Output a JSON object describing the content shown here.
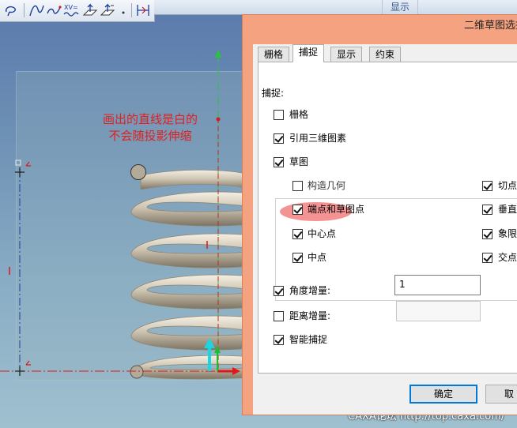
{
  "viewport": {
    "annotation": [
      "画出的直线是白的",
      "不会随投影伸缩"
    ],
    "annotation_color": "#e02020",
    "toolbar_icons": [
      "lasso-icon",
      "spline-icon",
      "curve-icon",
      "text-curve-icon",
      "plane-arrow-icon",
      "plane-arrow-2-icon",
      "point-icon",
      "reference-icon"
    ],
    "top_tab": "显示",
    "watermark": "CAXA论坛 http://top.caxa.com/"
  },
  "dialog": {
    "title": "二维草图选择",
    "tabs": [
      {
        "label": "栅格",
        "active": false
      },
      {
        "label": "捕捉",
        "active": true
      },
      {
        "label": "显示",
        "active": false
      },
      {
        "label": "约束",
        "active": false
      }
    ],
    "section_label": "捕捉:",
    "options": {
      "grid": {
        "label": "栅格",
        "checked": false
      },
      "ref3d": {
        "label": "引用三维图素",
        "checked": true
      },
      "sketch": {
        "label": "草图",
        "checked": true
      },
      "construction": {
        "label": "构造几何",
        "checked": false
      },
      "tangent": {
        "label": "切点",
        "checked": true
      },
      "endpoints": {
        "label": "端点和草图点",
        "checked": true
      },
      "perpendicular": {
        "label": "垂直",
        "checked": true
      },
      "center": {
        "label": "中心点",
        "checked": true
      },
      "quadrant": {
        "label": "象限点",
        "checked": true
      },
      "midpoint": {
        "label": "中点",
        "checked": true
      },
      "intersection": {
        "label": "交点",
        "checked": true
      },
      "angle_inc": {
        "label": "角度增量:",
        "checked": true
      },
      "distance_inc": {
        "label": "距离增量:",
        "checked": false
      },
      "smart": {
        "label": "智能捕捉",
        "checked": true
      }
    },
    "angle_value": "1",
    "distance_value": "",
    "ok_label": "确定",
    "cancel_label": "取"
  }
}
